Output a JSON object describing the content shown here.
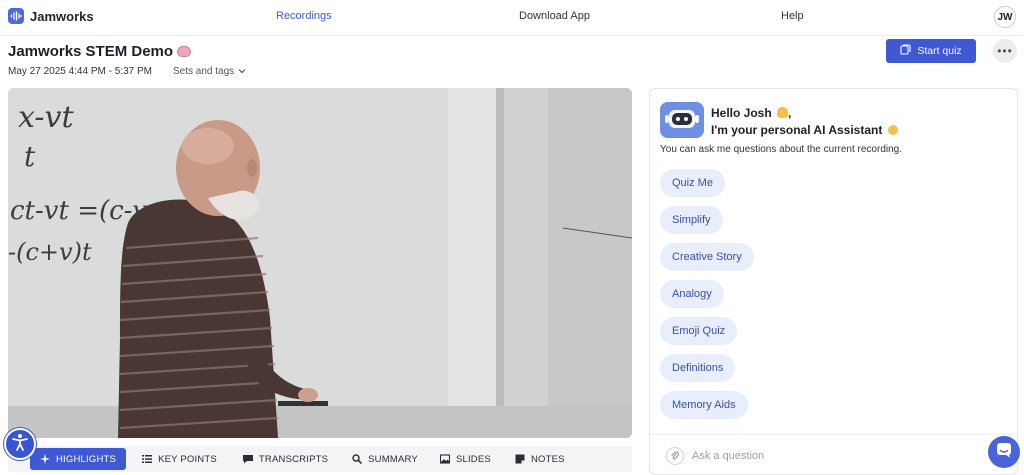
{
  "app": {
    "name": "Jamworks"
  },
  "nav": {
    "recordings": "Recordings",
    "download": "Download App",
    "help": "Help",
    "avatar_initials": "JW"
  },
  "recording": {
    "title": "Jamworks STEM Demo",
    "datetime": "May 27 2025 4:44 PM - 5:37 PM",
    "sets_tags": "Sets and tags"
  },
  "actions": {
    "start_quiz": "Start quiz"
  },
  "tabs": [
    {
      "label": "HIGHLIGHTS",
      "icon": "sparkle-icon",
      "active": true
    },
    {
      "label": "KEY POINTS",
      "icon": "list-icon",
      "active": false
    },
    {
      "label": "TRANSCRIPTS",
      "icon": "chat-bubble-icon",
      "active": false
    },
    {
      "label": "SUMMARY",
      "icon": "magnifier-icon",
      "active": false
    },
    {
      "label": "SLIDES",
      "icon": "image-icon",
      "active": false
    },
    {
      "label": "NOTES",
      "icon": "note-icon",
      "active": false
    }
  ],
  "assistant": {
    "greeting_line1": "Hello Josh",
    "greeting_line2": "I'm your personal AI Assistant",
    "intro": "You can ask me questions about the current recording.",
    "suggestions": [
      "Quiz Me",
      "Simplify",
      "Creative Story",
      "Analogy",
      "Emoji Quiz",
      "Definitions",
      "Memory Aids"
    ],
    "ask_placeholder": "Ask a question"
  },
  "whiteboard": {
    "line1": "x-vt",
    "line2": "t",
    "line3": "ct-vt =(c-v",
    "line4": "-(c+v)t"
  },
  "colors": {
    "accent": "#3f58d4",
    "chip_bg": "#e8eefb",
    "chip_text": "#3a4fae"
  }
}
